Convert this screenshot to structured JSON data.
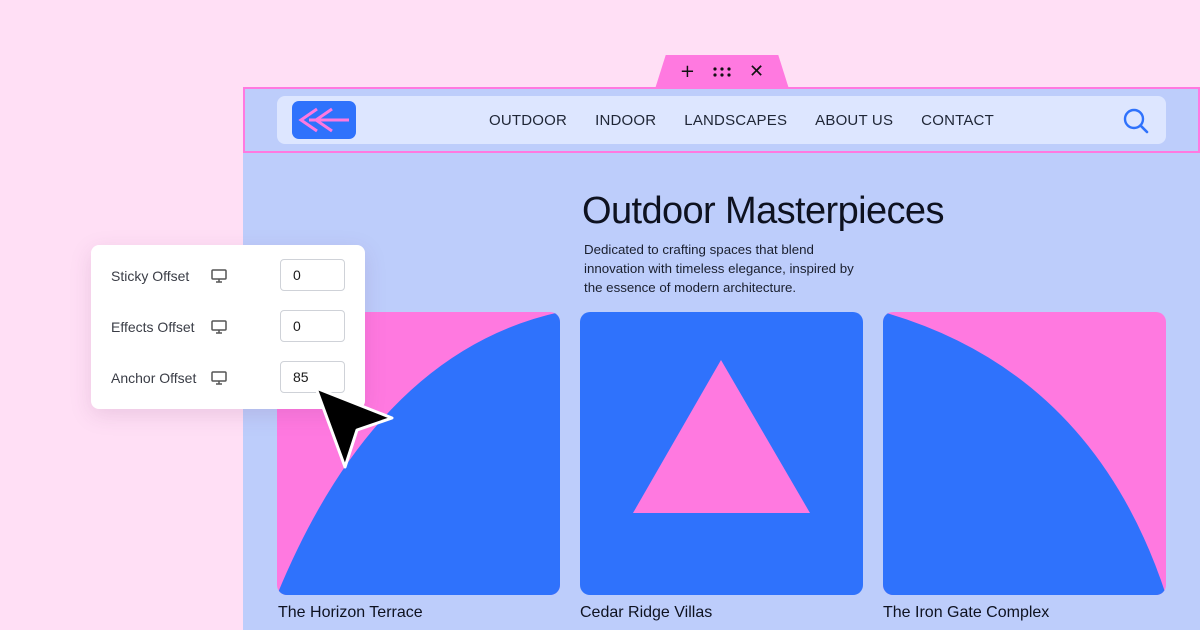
{
  "colors": {
    "background": "#ffdff5",
    "canvas": "#bdcdfb",
    "accent_pink": "#ff79e0",
    "accent_blue": "#2f72fc",
    "navbar_bg": "#dde6ff"
  },
  "element_toolbar": {
    "add_icon": "plus-icon",
    "drag_icon": "drag-handle-icon",
    "close_icon": "close-icon"
  },
  "header": {
    "logo_icon": "double-chevron-logo",
    "nav": [
      "OUTDOOR",
      "INDOOR",
      "LANDSCAPES",
      "ABOUT US",
      "CONTACT"
    ],
    "search_icon": "search-icon"
  },
  "hero": {
    "title": "Outdoor Masterpieces",
    "description": "Dedicated to crafting spaces that blend innovation with timeless elegance, inspired by the essence of modern architecture."
  },
  "cards": [
    {
      "title": "The Horizon Terrace"
    },
    {
      "title": "Cedar Ridge Villas"
    },
    {
      "title": "The Iron Gate Complex"
    }
  ],
  "settings_panel": {
    "rows": [
      {
        "label": "Sticky Offset",
        "value": "0",
        "device_icon": "desktop-icon"
      },
      {
        "label": "Effects Offset",
        "value": "0",
        "device_icon": "desktop-icon"
      },
      {
        "label": "Anchor Offset",
        "value": "85",
        "device_icon": "desktop-icon"
      }
    ]
  }
}
